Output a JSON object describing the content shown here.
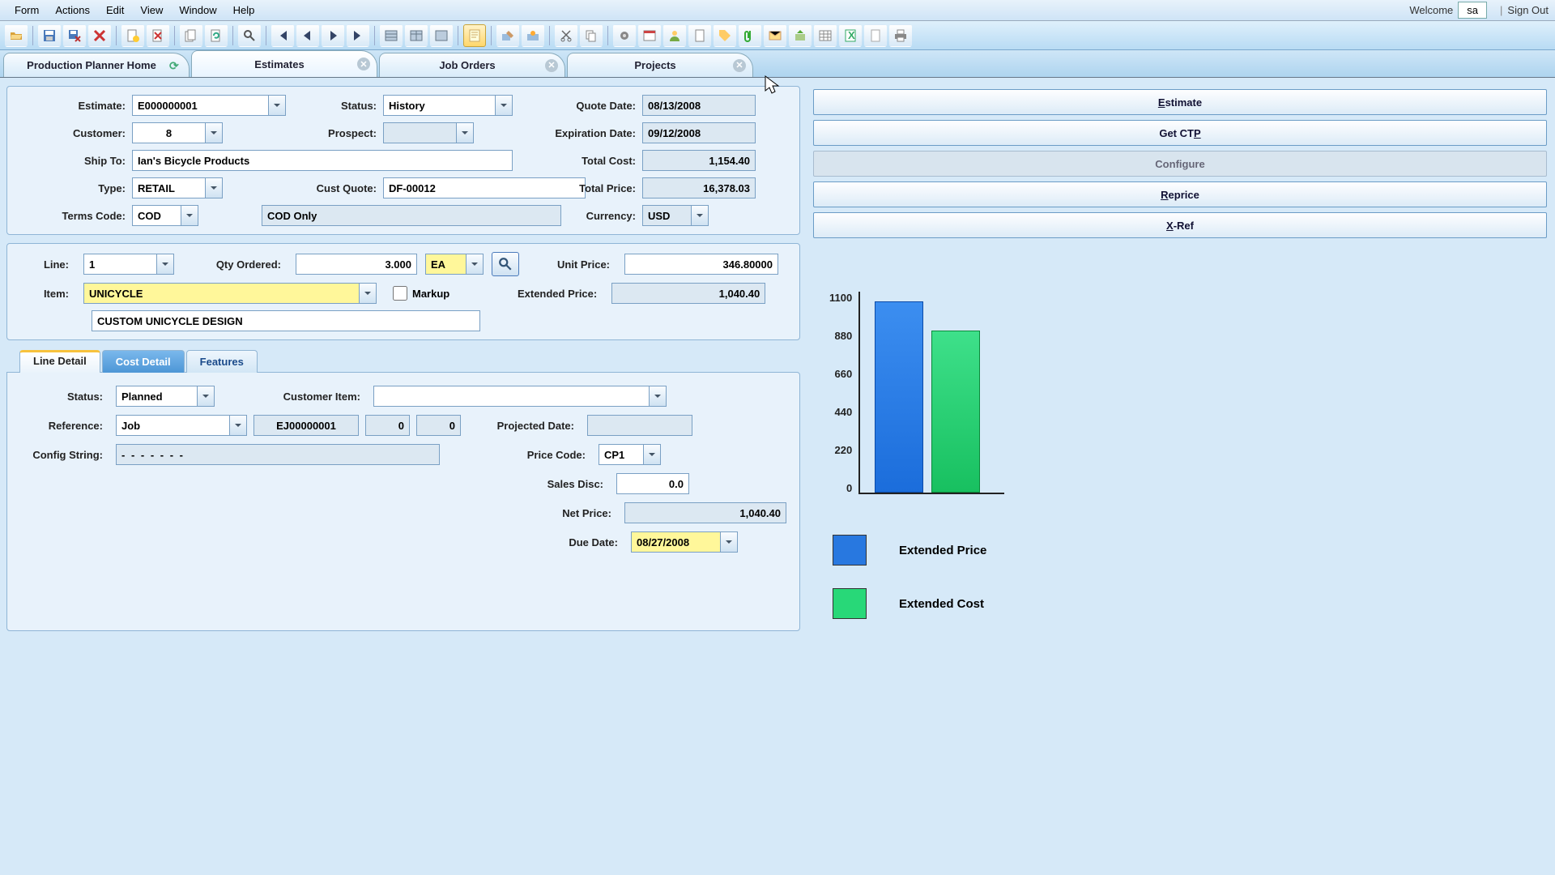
{
  "menu": {
    "form": "Form",
    "actions": "Actions",
    "edit": "Edit",
    "view": "View",
    "window": "Window",
    "help": "Help",
    "welcome": "Welcome",
    "user": "sa",
    "signout": "Sign Out"
  },
  "tabs": {
    "home": "Production Planner Home",
    "est": "Estimates",
    "job": "Job Orders",
    "proj": "Projects"
  },
  "hdr": {
    "estimate_lbl": "Estimate:",
    "estimate": "E000000001",
    "status_lbl": "Status:",
    "status": "History",
    "quote_lbl": "Quote Date:",
    "quote": "08/13/2008",
    "cust_lbl": "Customer:",
    "cust": "8",
    "prospect_lbl": "Prospect:",
    "prospect": "",
    "exp_lbl": "Expiration Date:",
    "exp": "09/12/2008",
    "ship_lbl": "Ship To:",
    "ship": "Ian's Bicycle Products",
    "tcost_lbl": "Total Cost:",
    "tcost": "1,154.40",
    "type_lbl": "Type:",
    "type": "RETAIL",
    "cq_lbl": "Cust Quote:",
    "cq": "DF-00012",
    "tprice_lbl": "Total Price:",
    "tprice": "16,378.03",
    "terms_lbl": "Terms Code:",
    "terms": "COD",
    "terms_desc": "COD Only",
    "curr_lbl": "Currency:",
    "curr": "USD"
  },
  "line": {
    "line_lbl": "Line:",
    "line": "1",
    "qty_lbl": "Qty Ordered:",
    "qty": "3.000",
    "uom": "EA",
    "up_lbl": "Unit Price:",
    "up": "346.80000",
    "item_lbl": "Item:",
    "item": "UNICYCLE",
    "markup_lbl": "Markup",
    "ep_lbl": "Extended Price:",
    "ep": "1,040.40",
    "desc": "CUSTOM UNICYCLE DESIGN"
  },
  "subtabs": {
    "ld": "Line Detail",
    "cd": "Cost Detail",
    "ft": "Features"
  },
  "det": {
    "status_lbl": "Status:",
    "status": "Planned",
    "ci_lbl": "Customer Item:",
    "ci": "",
    "ref_lbl": "Reference:",
    "ref": "Job",
    "refno": "EJ00000001",
    "ref_a": "0",
    "ref_b": "0",
    "pd_lbl": "Projected Date:",
    "pd": "",
    "cfg_lbl": "Config String:",
    "cfg": "-   -   -   -    -   -   -",
    "pc_lbl": "Price Code:",
    "pc": "CP1",
    "sd_lbl": "Sales Disc:",
    "sd": "0.0",
    "np_lbl": "Net Price:",
    "np": "1,040.40",
    "dd_lbl": "Due Date:",
    "dd": "08/27/2008"
  },
  "btns": {
    "est": "Estimate",
    "ctp": "Get CTP",
    "cfg": "Configure",
    "rep": "Reprice",
    "xref": "X-Ref"
  },
  "chart_data": {
    "type": "bar",
    "categories": [
      "Extended Price",
      "Extended Cost"
    ],
    "values": [
      1040,
      880
    ],
    "ylim": [
      0,
      1100
    ],
    "ticks": [
      0,
      220,
      440,
      660,
      880,
      1100
    ],
    "colors": [
      "#2878e0",
      "#28d878"
    ],
    "legend": [
      "Extended Price",
      "Extended Cost"
    ]
  }
}
